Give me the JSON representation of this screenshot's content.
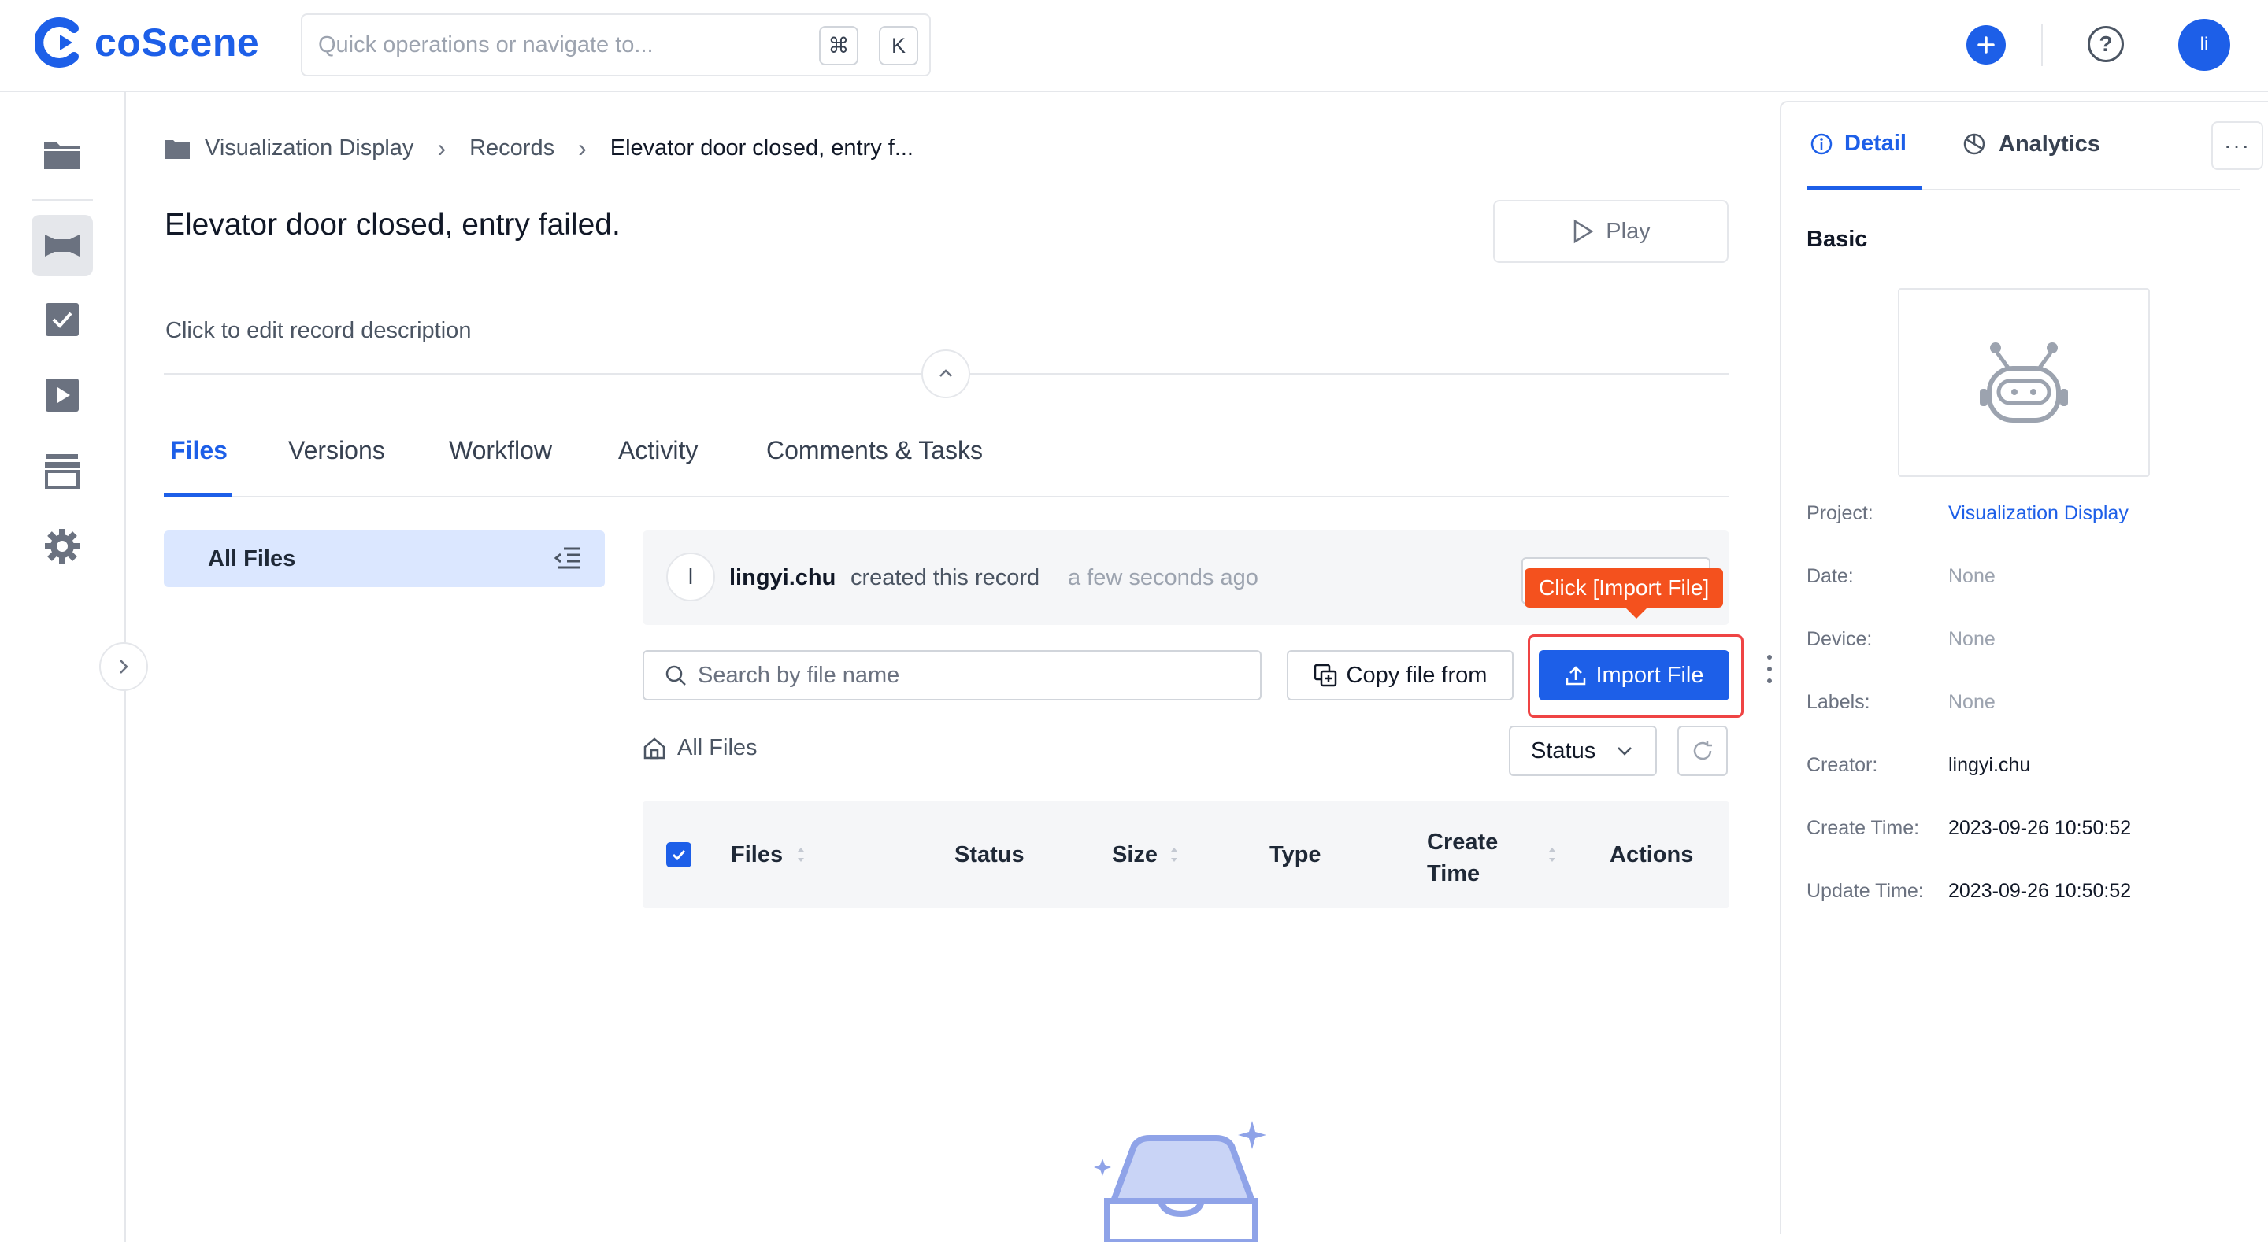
{
  "app": {
    "logo_text": "coScene",
    "search_placeholder": "Quick operations or navigate to...",
    "shortcut_key1": "⌘",
    "shortcut_key2": "K",
    "avatar_initials": "li"
  },
  "breadcrumb": {
    "items": [
      "Visualization Display",
      "Records",
      "Elevator door closed, entry f..."
    ]
  },
  "record": {
    "title": "Elevator door closed, entry failed.",
    "play_label": "Play",
    "description_placeholder": "Click to edit record description"
  },
  "tabs": [
    "Files",
    "Versions",
    "Workflow",
    "Activity",
    "Comments & Tasks"
  ],
  "active_tab": "Files",
  "files_panel": {
    "sidebar_label": "All Files",
    "activity": {
      "avatar": "l",
      "user": "lingyi.chu",
      "action": "created this record",
      "time": "a few seconds ago"
    },
    "tooltip": "Click [Import File]",
    "search_placeholder": "Search by file name",
    "copy_button": "Copy file from",
    "import_button": "Import File",
    "path_label": "All Files",
    "status_filter": "Status",
    "columns": [
      "Files",
      "Status",
      "Size",
      "Type",
      "Create Time",
      "Actions"
    ]
  },
  "right_panel": {
    "tabs": [
      "Detail",
      "Analytics"
    ],
    "more": "···",
    "section": "Basic",
    "fields": [
      {
        "label": "Project:",
        "value": "Visualization Display"
      },
      {
        "label": "Date:",
        "value": "None"
      },
      {
        "label": "Device:",
        "value": "None"
      },
      {
        "label": "Labels:",
        "value": "None"
      },
      {
        "label": "Creator:",
        "value": "lingyi.chu"
      },
      {
        "label": "Create Time:",
        "value": "2023-09-26 10:50:52"
      },
      {
        "label": "Update Time:",
        "value": "2023-09-26 10:50:52"
      }
    ]
  },
  "colors": {
    "accent": "#1d5fe8",
    "highlight": "#ef4444",
    "tooltip": "#f4511e"
  },
  "icons": [
    "logo-icon",
    "command-key",
    "plus-icon",
    "help-icon",
    "folder-icon",
    "records-icon",
    "tasks-icon",
    "play-icon",
    "archive-icon",
    "gear-icon",
    "chevron-right-icon",
    "chevron-up-icon",
    "list-collapse-icon",
    "search-icon",
    "copy-icon",
    "upload-icon",
    "home-icon",
    "chevron-down-icon",
    "refresh-icon",
    "info-icon",
    "analytics-icon",
    "robot-icon",
    "empty-box-icon"
  ]
}
